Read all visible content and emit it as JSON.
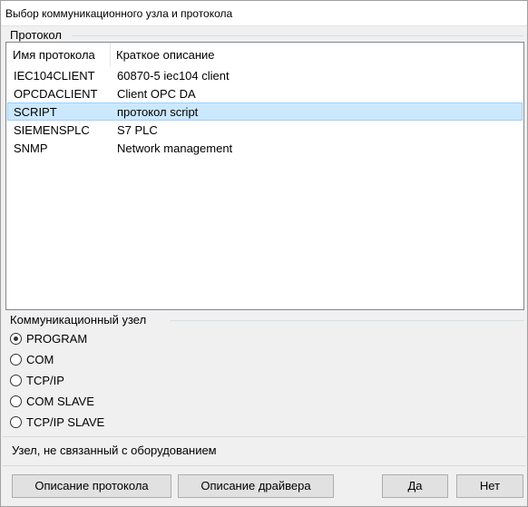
{
  "window": {
    "title": "Выбор коммуникационного узла и протокола"
  },
  "protocol_group": {
    "label": "Протокол",
    "columns": [
      "Имя протокола",
      "Краткое описание"
    ],
    "rows": [
      {
        "name": "IEC104CLIENT",
        "description": "60870-5 iec104 client",
        "selected": false
      },
      {
        "name": "OPCDACLIENT",
        "description": "Client OPC DA",
        "selected": false
      },
      {
        "name": "SCRIPT",
        "description": "протокол script",
        "selected": true
      },
      {
        "name": "SIEMENSPLC",
        "description": "S7 PLC",
        "selected": false
      },
      {
        "name": "SNMP",
        "description": "Network management",
        "selected": false
      }
    ]
  },
  "node_group": {
    "label": "Коммуникационный узел",
    "options": [
      {
        "label": "PROGRAM",
        "checked": true
      },
      {
        "label": "COM",
        "checked": false
      },
      {
        "label": "TCP/IP",
        "checked": false
      },
      {
        "label": "COM SLAVE",
        "checked": false
      },
      {
        "label": "TCP/IP SLAVE",
        "checked": false
      }
    ]
  },
  "status": {
    "text": "Узел, не связанный с оборудованием"
  },
  "buttons": {
    "protocol_description": "Описание протокола",
    "driver_description": "Описание драйвера",
    "ok": "Да",
    "cancel": "Нет"
  },
  "colors": {
    "selection_bg": "#cce8ff",
    "selection_border": "#99d1ff",
    "window_bg": "#f0f0f0"
  }
}
